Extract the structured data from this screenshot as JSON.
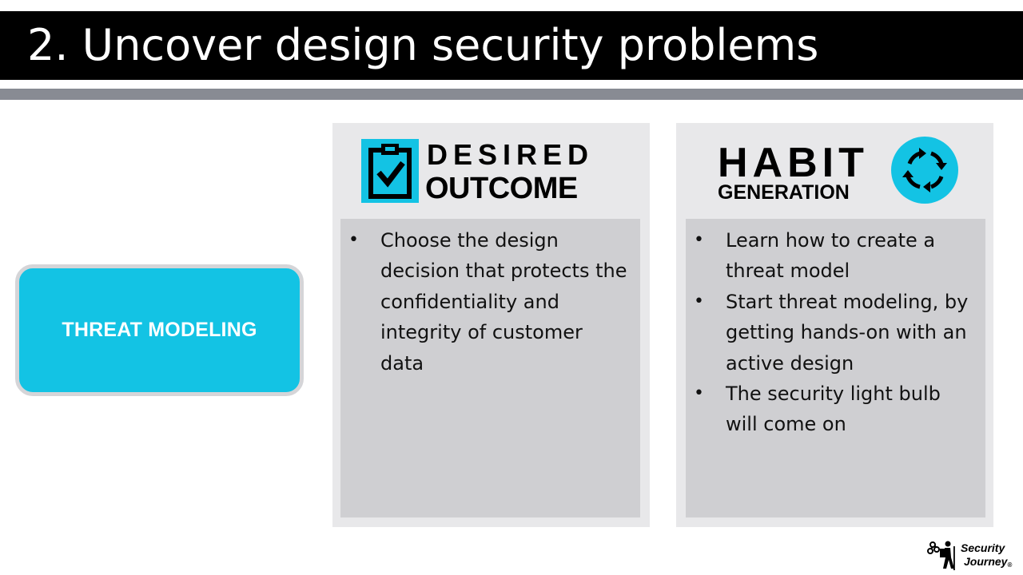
{
  "slide": {
    "title": "2. Uncover design security problems",
    "topic_label": "THREAT MODELING"
  },
  "desired_outcome": {
    "heading_line1": "DESIRED",
    "heading_line2": "OUTCOME",
    "icon": "clipboard-check-icon",
    "bullets": [
      "Choose the design decision that protects the confidentiality and integrity of customer data"
    ]
  },
  "habit_generation": {
    "heading_line1": "HABIT",
    "heading_line2": "GENERATION",
    "icon": "cycle-arrows-icon",
    "bullets": [
      "Learn how to create a threat model",
      "Start threat modeling, by getting hands-on with an active design",
      "The security light bulb will come on"
    ]
  },
  "logo": {
    "line1": "Security",
    "line2": "Journey",
    "mark": "®"
  },
  "colors": {
    "accent": "#13c3e4",
    "title_bar": "#000000",
    "rule": "#888b93",
    "panel": "#e8e8ea",
    "panel_body": "#cfcfd2"
  }
}
